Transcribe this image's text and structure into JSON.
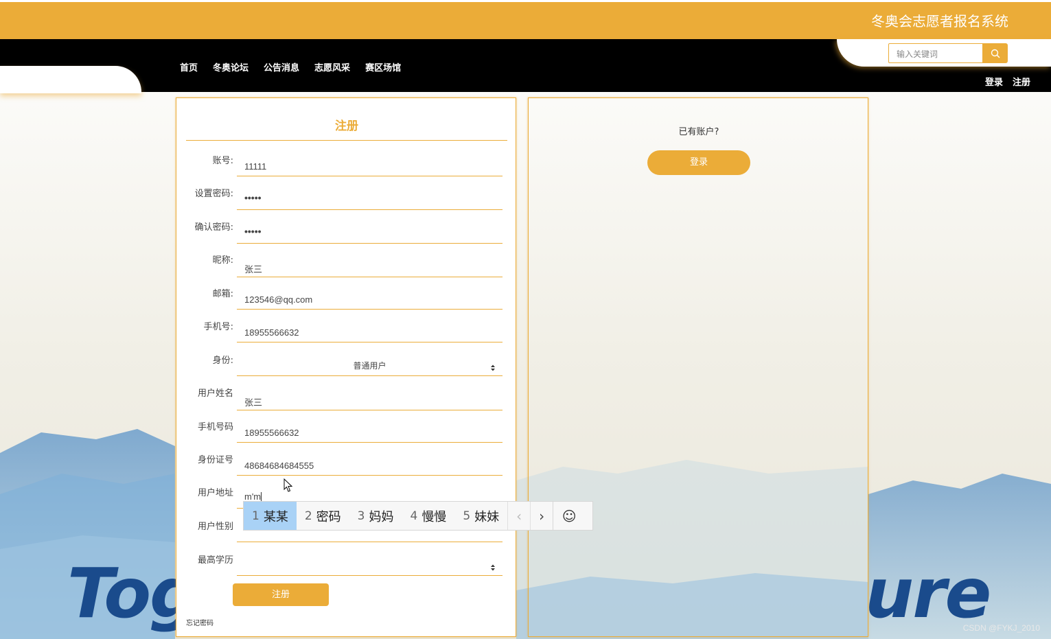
{
  "header": {
    "site_title": "冬奥会志愿者报名系统",
    "nav": [
      "首页",
      "冬奥论坛",
      "公告消息",
      "志愿风采",
      "赛区场馆"
    ],
    "search_placeholder": "输入关键词",
    "login_label": "登录",
    "register_label": "注册"
  },
  "register_form": {
    "title": "注册",
    "fields": [
      {
        "label": "账号:",
        "value": "11111"
      },
      {
        "label": "设置密码:",
        "value": "•••••"
      },
      {
        "label": "确认密码:",
        "value": "•••••"
      },
      {
        "label": "昵称:",
        "value": "张三"
      },
      {
        "label": "邮箱:",
        "value": "123546@qq.com"
      },
      {
        "label": "手机号:",
        "value": "18955566632"
      },
      {
        "label": "身份:",
        "value": "普通用户"
      },
      {
        "label": "用户姓名",
        "value": "张三"
      },
      {
        "label": "手机号码",
        "value": "18955566632"
      },
      {
        "label": "身份证号",
        "value": "48684684684555"
      },
      {
        "label": "用户地址",
        "value": "m'm"
      },
      {
        "label": "用户性别",
        "value": ""
      },
      {
        "label": "最高学历",
        "value": ""
      }
    ],
    "submit_label": "注册",
    "forgot_label": "忘记密码"
  },
  "login_panel": {
    "prompt": "已有账户?",
    "login_label": "登录"
  },
  "ime": {
    "candidates": [
      {
        "num": "1",
        "text": "某某"
      },
      {
        "num": "2",
        "text": "密码"
      },
      {
        "num": "3",
        "text": "妈妈"
      },
      {
        "num": "4",
        "text": "慢慢"
      },
      {
        "num": "5",
        "text": "妹妹"
      }
    ],
    "prev": "‹",
    "next": "›",
    "emoji": "☺"
  },
  "background": {
    "text_left": "Tog",
    "text_right": "ure"
  },
  "watermark": "CSDN @FYKJ_2010",
  "colors": {
    "accent": "#ebac38",
    "nav_bg": "#000000",
    "ime_active": "#a9d2f6"
  }
}
